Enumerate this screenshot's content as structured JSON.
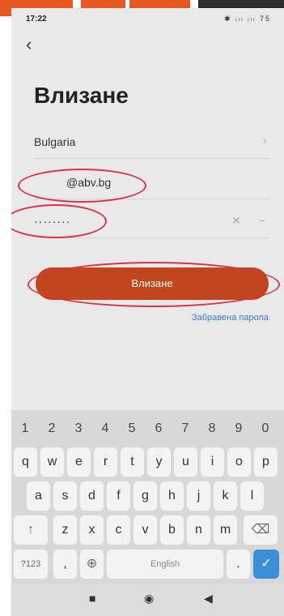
{
  "status": {
    "time": "17:22",
    "icons": "✱ ᵢₗₗ ᵢₗₗ 75"
  },
  "screen": {
    "back": "‹",
    "title": "Влизане"
  },
  "form": {
    "country": "Bulgaria",
    "email": "@abv.bg",
    "password": "········",
    "login_label": "Влизане",
    "forgot": "Забравена парола"
  },
  "keyboard": {
    "numbers": [
      "1",
      "2",
      "3",
      "4",
      "5",
      "6",
      "7",
      "8",
      "9",
      "0"
    ],
    "row1": [
      "q",
      "w",
      "e",
      "r",
      "t",
      "y",
      "u",
      "i",
      "o",
      "p"
    ],
    "row2": [
      "a",
      "s",
      "d",
      "f",
      "g",
      "h",
      "j",
      "k",
      "l"
    ],
    "row3": [
      "z",
      "x",
      "c",
      "v",
      "b",
      "n",
      "m"
    ],
    "symbols_label": "?123",
    "comma": ",",
    "space_label": "English",
    "period": "."
  },
  "accent": "#c2461d",
  "highlight_color": "#d9334a"
}
